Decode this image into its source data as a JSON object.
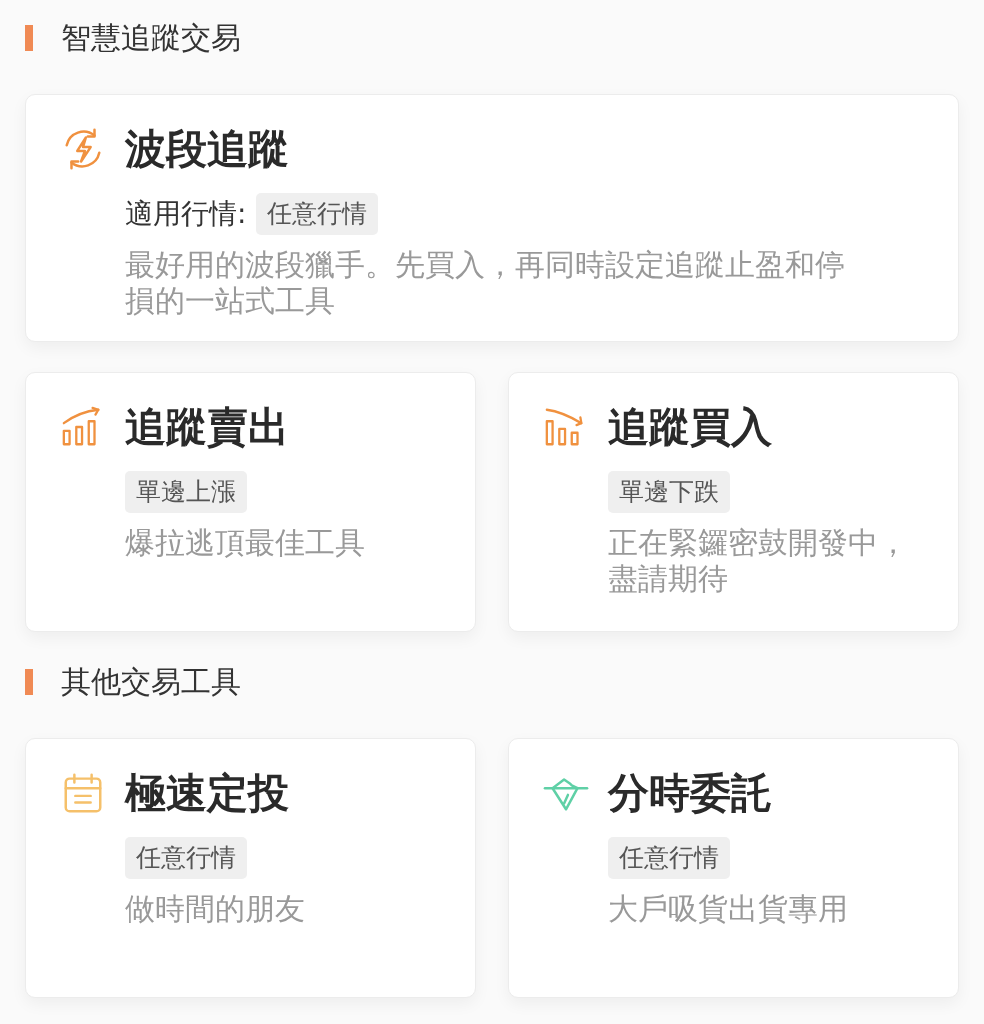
{
  "sections": [
    {
      "title": "智慧追蹤交易",
      "cards": [
        {
          "kind": "cycle-bolt",
          "title": "波段追蹤",
          "tag_label": "適用行情:",
          "tag": "任意行情",
          "description": "最好用的波段獵手。先買入，再同時設定追蹤止盈和停損的一站式工具"
        },
        {
          "kind": "bars-up",
          "title": "追蹤賣出",
          "tag": "單邊上漲",
          "description": "爆拉逃頂最佳工具"
        },
        {
          "kind": "bars-down",
          "title": "追蹤買入",
          "tag": "單邊下跌",
          "description": "正在緊鑼密鼓開發中，盡請期待"
        }
      ]
    },
    {
      "title": "其他交易工具",
      "cards": [
        {
          "kind": "calendar",
          "title": "極速定投",
          "tag": "任意行情",
          "description": "做時間的朋友"
        },
        {
          "kind": "iceberg",
          "title": "分時委託",
          "tag": "任意行情",
          "description": "大戶吸貨出貨專用"
        }
      ]
    }
  ]
}
